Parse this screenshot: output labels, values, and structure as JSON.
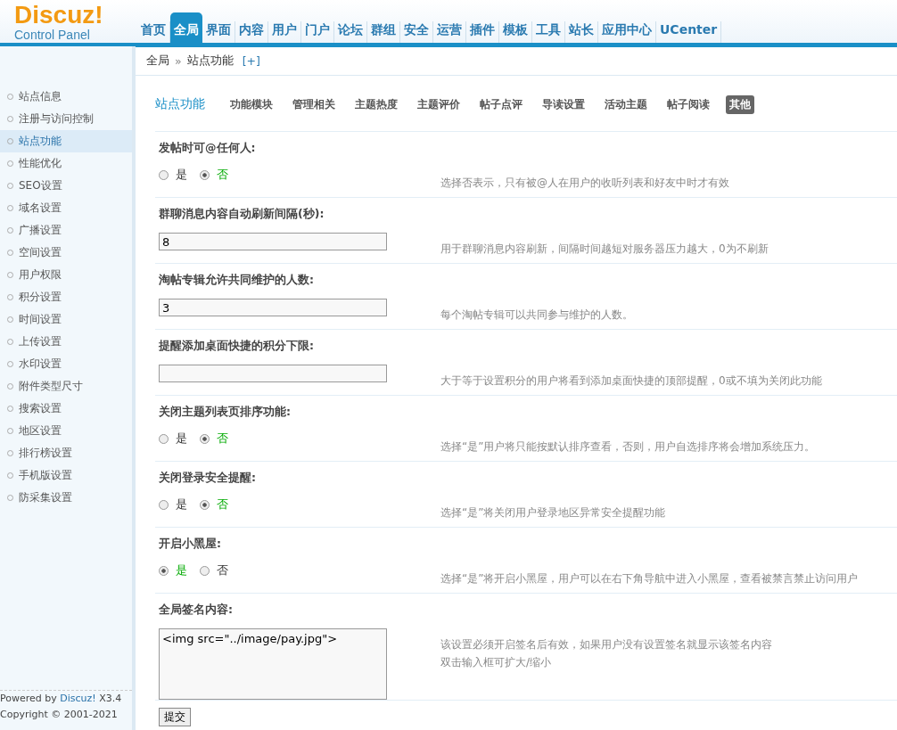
{
  "logo": {
    "name": "Discuz!",
    "subtitle": "Control Panel"
  },
  "nav": [
    {
      "label": "首页",
      "selected": false
    },
    {
      "label": "全局",
      "selected": true
    },
    {
      "label": "界面",
      "selected": false
    },
    {
      "label": "内容",
      "selected": false
    },
    {
      "label": "用户",
      "selected": false
    },
    {
      "label": "门户",
      "selected": false
    },
    {
      "label": "论坛",
      "selected": false
    },
    {
      "label": "群组",
      "selected": false
    },
    {
      "label": "安全",
      "selected": false
    },
    {
      "label": "运营",
      "selected": false
    },
    {
      "label": "插件",
      "selected": false
    },
    {
      "label": "模板",
      "selected": false
    },
    {
      "label": "工具",
      "selected": false
    },
    {
      "label": "站长",
      "selected": false
    },
    {
      "label": "应用中心",
      "selected": false
    },
    {
      "label": "UCenter",
      "selected": false
    }
  ],
  "breadcrumb": {
    "items": [
      "全局",
      "站点功能"
    ],
    "separator": "»",
    "add": "[+]"
  },
  "sidebar": {
    "items": [
      {
        "label": "站点信息",
        "selected": false
      },
      {
        "label": "注册与访问控制",
        "selected": false
      },
      {
        "label": "站点功能",
        "selected": true
      },
      {
        "label": "性能优化",
        "selected": false
      },
      {
        "label": "SEO设置",
        "selected": false
      },
      {
        "label": "域名设置",
        "selected": false
      },
      {
        "label": "广播设置",
        "selected": false
      },
      {
        "label": "空间设置",
        "selected": false
      },
      {
        "label": "用户权限",
        "selected": false
      },
      {
        "label": "积分设置",
        "selected": false
      },
      {
        "label": "时间设置",
        "selected": false
      },
      {
        "label": "上传设置",
        "selected": false
      },
      {
        "label": "水印设置",
        "selected": false
      },
      {
        "label": "附件类型尺寸",
        "selected": false
      },
      {
        "label": "搜索设置",
        "selected": false
      },
      {
        "label": "地区设置",
        "selected": false
      },
      {
        "label": "排行榜设置",
        "selected": false
      },
      {
        "label": "手机版设置",
        "selected": false
      },
      {
        "label": "防采集设置",
        "selected": false
      }
    ],
    "footer": {
      "powered": "Powered by",
      "brand": "Discuz!",
      "version": "X3.4",
      "copyright": "Copyright © 2001-2021"
    }
  },
  "page_title": "站点功能",
  "subtabs": [
    {
      "label": "功能模块",
      "selected": false
    },
    {
      "label": "管理相关",
      "selected": false
    },
    {
      "label": "主题热度",
      "selected": false
    },
    {
      "label": "主题评价",
      "selected": false
    },
    {
      "label": "帖子点评",
      "selected": false
    },
    {
      "label": "导读设置",
      "selected": false
    },
    {
      "label": "活动主题",
      "selected": false
    },
    {
      "label": "帖子阅读",
      "selected": false
    },
    {
      "label": "其他",
      "selected": true
    }
  ],
  "settings": [
    {
      "kind": "radio",
      "label": "发帖时可@任何人:",
      "options": [
        {
          "label": "是",
          "selected": false
        },
        {
          "label": "否",
          "selected": true
        }
      ],
      "description": "选择否表示，只有被@人在用户的收听列表和好友中时才有效"
    },
    {
      "kind": "text",
      "label": "群聊消息内容自动刷新间隔(秒):",
      "value": "8",
      "description": "用于群聊消息内容刷新，间隔时间越短对服务器压力越大，0为不刷新"
    },
    {
      "kind": "text",
      "label": "淘帖专辑允许共同维护的人数:",
      "value": "3",
      "description": "每个淘帖专辑可以共同参与维护的人数。"
    },
    {
      "kind": "text",
      "label": "提醒添加桌面快捷的积分下限:",
      "description": "大于等于设置积分的用户将看到添加桌面快捷的顶部提醒，0或不填为关闭此功能"
    },
    {
      "kind": "radio",
      "label": "关闭主题列表页排序功能:",
      "options": [
        {
          "label": "是",
          "selected": false
        },
        {
          "label": "否",
          "selected": true
        }
      ],
      "description": "选择“是”用户将只能按默认排序查看，否则，用户自选排序将会增加系统压力。"
    },
    {
      "kind": "radio",
      "label": "关闭登录安全提醒:",
      "options": [
        {
          "label": "是",
          "selected": false
        },
        {
          "label": "否",
          "selected": true
        }
      ],
      "description": "选择“是”将关闭用户登录地区异常安全提醒功能"
    },
    {
      "kind": "radio",
      "label": "开启小黑屋:",
      "options": [
        {
          "label": "是",
          "selected": true
        },
        {
          "label": "否",
          "selected": false
        }
      ],
      "description": "选择“是”将开启小黑屋，用户可以在右下角导航中进入小黑屋，查看被禁言禁止访问用户"
    },
    {
      "kind": "textarea",
      "label": "全局签名内容:",
      "value": "<img src=\"../image/pay.jpg\">",
      "description": "该设置必须开启签名后有效，如果用户没有设置签名就显示该签名内容",
      "hint": "双击输入框可扩大/缩小"
    }
  ],
  "submit": "提交"
}
